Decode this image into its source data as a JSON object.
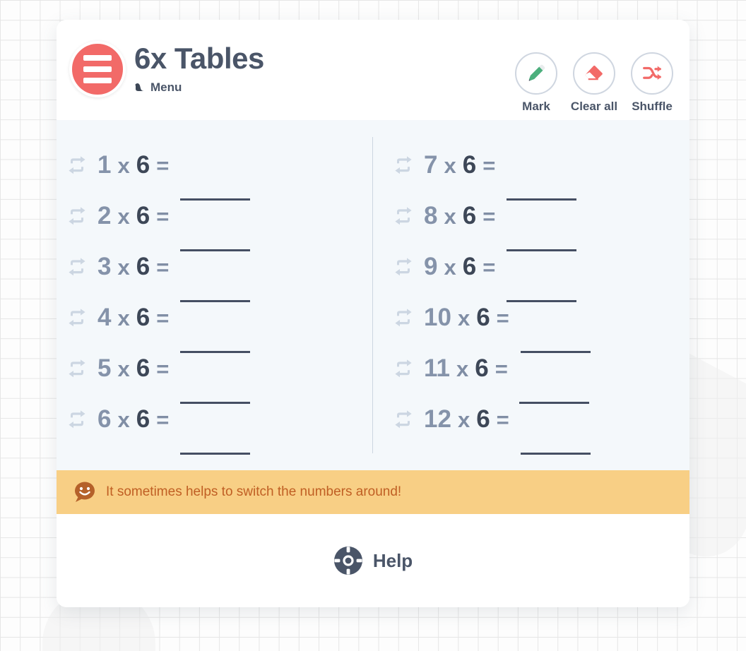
{
  "app": {
    "title": "6x Tables",
    "menu_label": "Menu",
    "menu_icon": "hamburger-icon",
    "back_icon": "back-arrow-icon",
    "accent_color": "#f26a68",
    "text_color": "#4a5568",
    "banner_color": "#f8cf85",
    "body_color": "#f4f8fb"
  },
  "toolbar": [
    {
      "id": "mark",
      "label": "Mark",
      "icon": "pencil-icon",
      "color": "#4caf7d"
    },
    {
      "id": "clear-all",
      "label": "Clear all",
      "icon": "eraser-icon",
      "color": "#f26a68"
    },
    {
      "id": "shuffle",
      "label": "Shuffle",
      "icon": "shuffle-icon",
      "color": "#f26a68"
    }
  ],
  "questions": {
    "swap_icon": "swap-arrows-icon",
    "operator": "x",
    "equals": "=",
    "base": "6",
    "answer_placeholder": "",
    "left": [
      {
        "multiplier": "1",
        "answer": ""
      },
      {
        "multiplier": "2",
        "answer": ""
      },
      {
        "multiplier": "3",
        "answer": ""
      },
      {
        "multiplier": "4",
        "answer": ""
      },
      {
        "multiplier": "5",
        "answer": ""
      },
      {
        "multiplier": "6",
        "answer": ""
      }
    ],
    "right": [
      {
        "multiplier": "7",
        "answer": ""
      },
      {
        "multiplier": "8",
        "answer": ""
      },
      {
        "multiplier": "9",
        "answer": ""
      },
      {
        "multiplier": "10",
        "answer": ""
      },
      {
        "multiplier": "11",
        "answer": ""
      },
      {
        "multiplier": "12",
        "answer": ""
      }
    ]
  },
  "hint": {
    "icon": "smiley-speech-bubble-icon",
    "text": "It sometimes helps to switch the numbers around!"
  },
  "help": {
    "icon": "life-ring-icon",
    "label": "Help"
  }
}
